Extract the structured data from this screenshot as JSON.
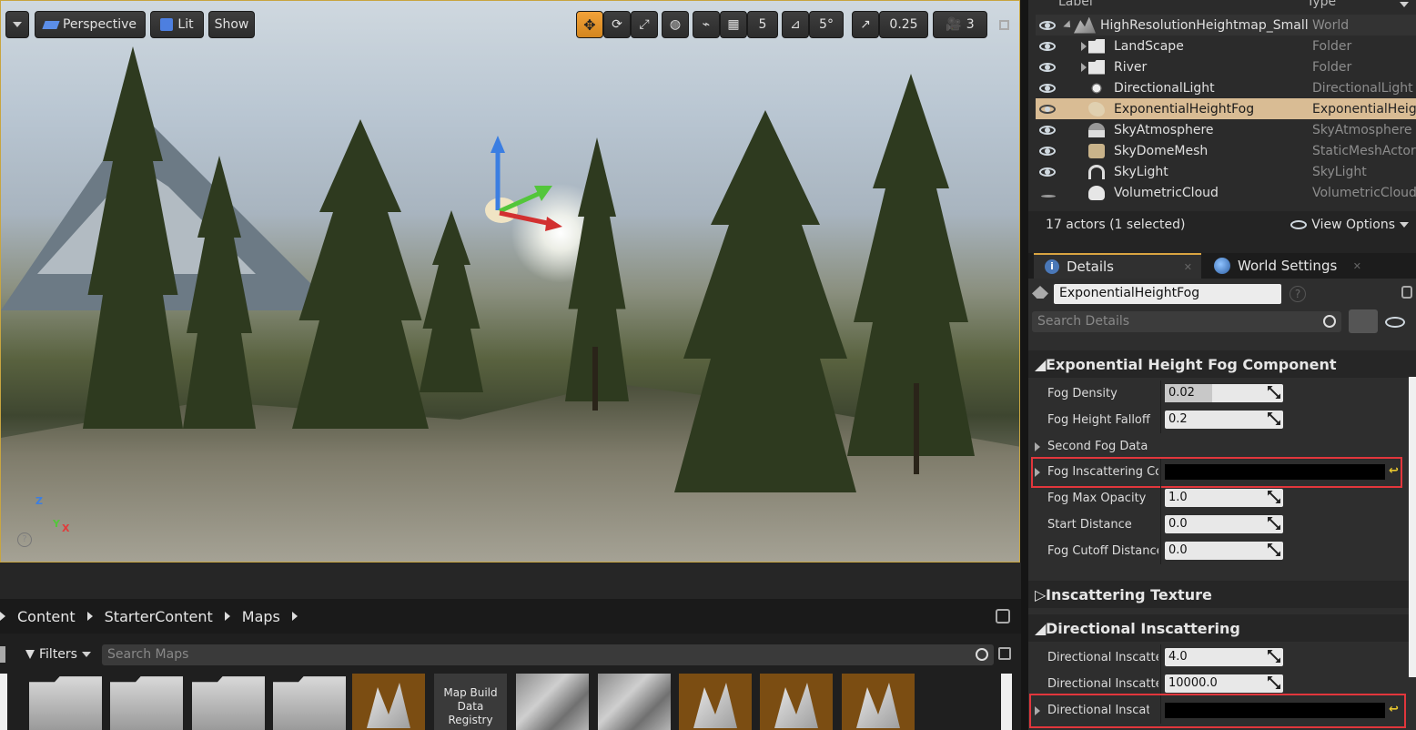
{
  "viewport": {
    "perspective_label": "Perspective",
    "lit_label": "Lit",
    "show_label": "Show",
    "grid_snap_value": "5",
    "rotation_snap_value": "5°",
    "scale_snap_value": "0.25",
    "camera_speed_value": "3",
    "accent_color": "#d3861e"
  },
  "content_browser": {
    "breadcrumb": [
      "Content",
      "StarterContent",
      "Maps"
    ],
    "filters_label": "Filters",
    "search_placeholder": "Search Maps",
    "tiles": [
      {
        "kind": "folder"
      },
      {
        "kind": "folder"
      },
      {
        "kind": "folder"
      },
      {
        "kind": "folder"
      },
      {
        "kind": "map"
      },
      {
        "kind": "registry",
        "label": "Map Build Data Registry"
      },
      {
        "kind": "heightmap"
      },
      {
        "kind": "heightmap"
      },
      {
        "kind": "map"
      },
      {
        "kind": "map"
      },
      {
        "kind": "map"
      }
    ]
  },
  "outliner": {
    "header_label": "Label",
    "header_type": "Type",
    "rows": [
      {
        "label": "HighResolutionHeightmap_Small",
        "type": "World",
        "icon": "world-icon"
      },
      {
        "label": "LandScape",
        "type": "Folder",
        "icon": "folder-icon"
      },
      {
        "label": "River",
        "type": "Folder",
        "icon": "folder-icon"
      },
      {
        "label": "DirectionalLight",
        "type": "DirectionalLight",
        "icon": "light-icon"
      },
      {
        "label": "ExponentialHeightFog",
        "type": "ExponentialHeig",
        "icon": "fog-icon",
        "selected": true
      },
      {
        "label": "SkyAtmosphere",
        "type": "SkyAtmosphere",
        "icon": "sky-icon"
      },
      {
        "label": "SkyDomeMesh",
        "type": "StaticMeshActor",
        "icon": "mesh-icon"
      },
      {
        "label": "SkyLight",
        "type": "SkyLight",
        "icon": "skylight-icon"
      },
      {
        "label": "VolumetricCloud",
        "type": "VolumetricCloud",
        "icon": "cloud-icon"
      }
    ],
    "actor_count": "17 actors (1 selected)",
    "view_options_label": "View Options"
  },
  "details": {
    "tabs": [
      "Details",
      "World Settings"
    ],
    "object_name": "ExponentialHeightFog",
    "search_placeholder": "Search Details",
    "fog_category": "Exponential Height Fog Component",
    "fog_props": {
      "fog_density_label": "Fog Density",
      "fog_density_value": "0.02",
      "fog_density_fraction": 0.4,
      "fog_height_falloff_label": "Fog Height Falloff",
      "fog_height_falloff_value": "0.2",
      "second_fog_data_label": "Second Fog Data",
      "fog_inscattering_color_label": "Fog Inscattering Colo",
      "fog_max_opacity_label": "Fog Max Opacity",
      "fog_max_opacity_value": "1.0",
      "start_distance_label": "Start Distance",
      "start_distance_value": "0.0",
      "fog_cutoff_distance_label": "Fog Cutoff Distance",
      "fog_cutoff_distance_value": "0.0"
    },
    "inscattering_texture_category": "Inscattering Texture",
    "directional_category": "Directional Inscattering",
    "directional_props": {
      "exponent_label": "Directional Inscatterir",
      "exponent_value": "4.0",
      "start_distance_label": "Directional Inscatterir",
      "start_distance_value": "10000.0",
      "color_label": "Directional Inscatteri"
    },
    "highlight_color": "#e2363c"
  }
}
